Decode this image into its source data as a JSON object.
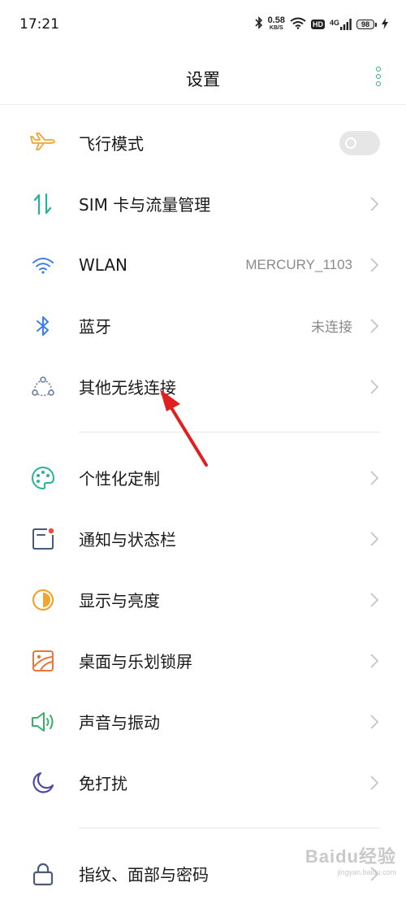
{
  "status_bar": {
    "time": "17:21",
    "net_speed_value": "0.58",
    "net_speed_unit": "KB/S",
    "hd_label": "HD",
    "signal_label": "4G",
    "battery": "98"
  },
  "header": {
    "title": "设置",
    "more_icon": "more-vertical-icon",
    "accent_color": "#2db36a"
  },
  "groups": [
    {
      "items": [
        {
          "label": "飞行模式",
          "icon": "airplane-icon",
          "control": "toggle",
          "toggle_on": false
        },
        {
          "label": "SIM 卡与流量管理",
          "icon": "sim-data-icon",
          "control": "chevron"
        },
        {
          "label": "WLAN",
          "icon": "wifi-icon",
          "value": "MERCURY_1103",
          "control": "chevron"
        },
        {
          "label": "蓝牙",
          "icon": "bluetooth-icon",
          "value": "未连接",
          "control": "chevron"
        },
        {
          "label": "其他无线连接",
          "icon": "wireless-connection-icon",
          "control": "chevron"
        }
      ]
    },
    {
      "items": [
        {
          "label": "个性化定制",
          "icon": "palette-icon",
          "control": "chevron"
        },
        {
          "label": "通知与状态栏",
          "icon": "notification-icon",
          "control": "chevron"
        },
        {
          "label": "显示与亮度",
          "icon": "brightness-icon",
          "control": "chevron"
        },
        {
          "label": "桌面与乐划锁屏",
          "icon": "wallpaper-icon",
          "control": "chevron"
        },
        {
          "label": "声音与振动",
          "icon": "sound-icon",
          "control": "chevron"
        },
        {
          "label": "免打扰",
          "icon": "moon-icon",
          "control": "chevron"
        }
      ]
    },
    {
      "items": [
        {
          "label": "指纹、面部与密码",
          "icon": "lock-icon",
          "control": "chevron"
        }
      ]
    }
  ],
  "annotation": {
    "color": "#e02020",
    "type": "arrow"
  },
  "watermark": {
    "brand": "Baidu经验",
    "site": "jingyan.baidu.com"
  }
}
